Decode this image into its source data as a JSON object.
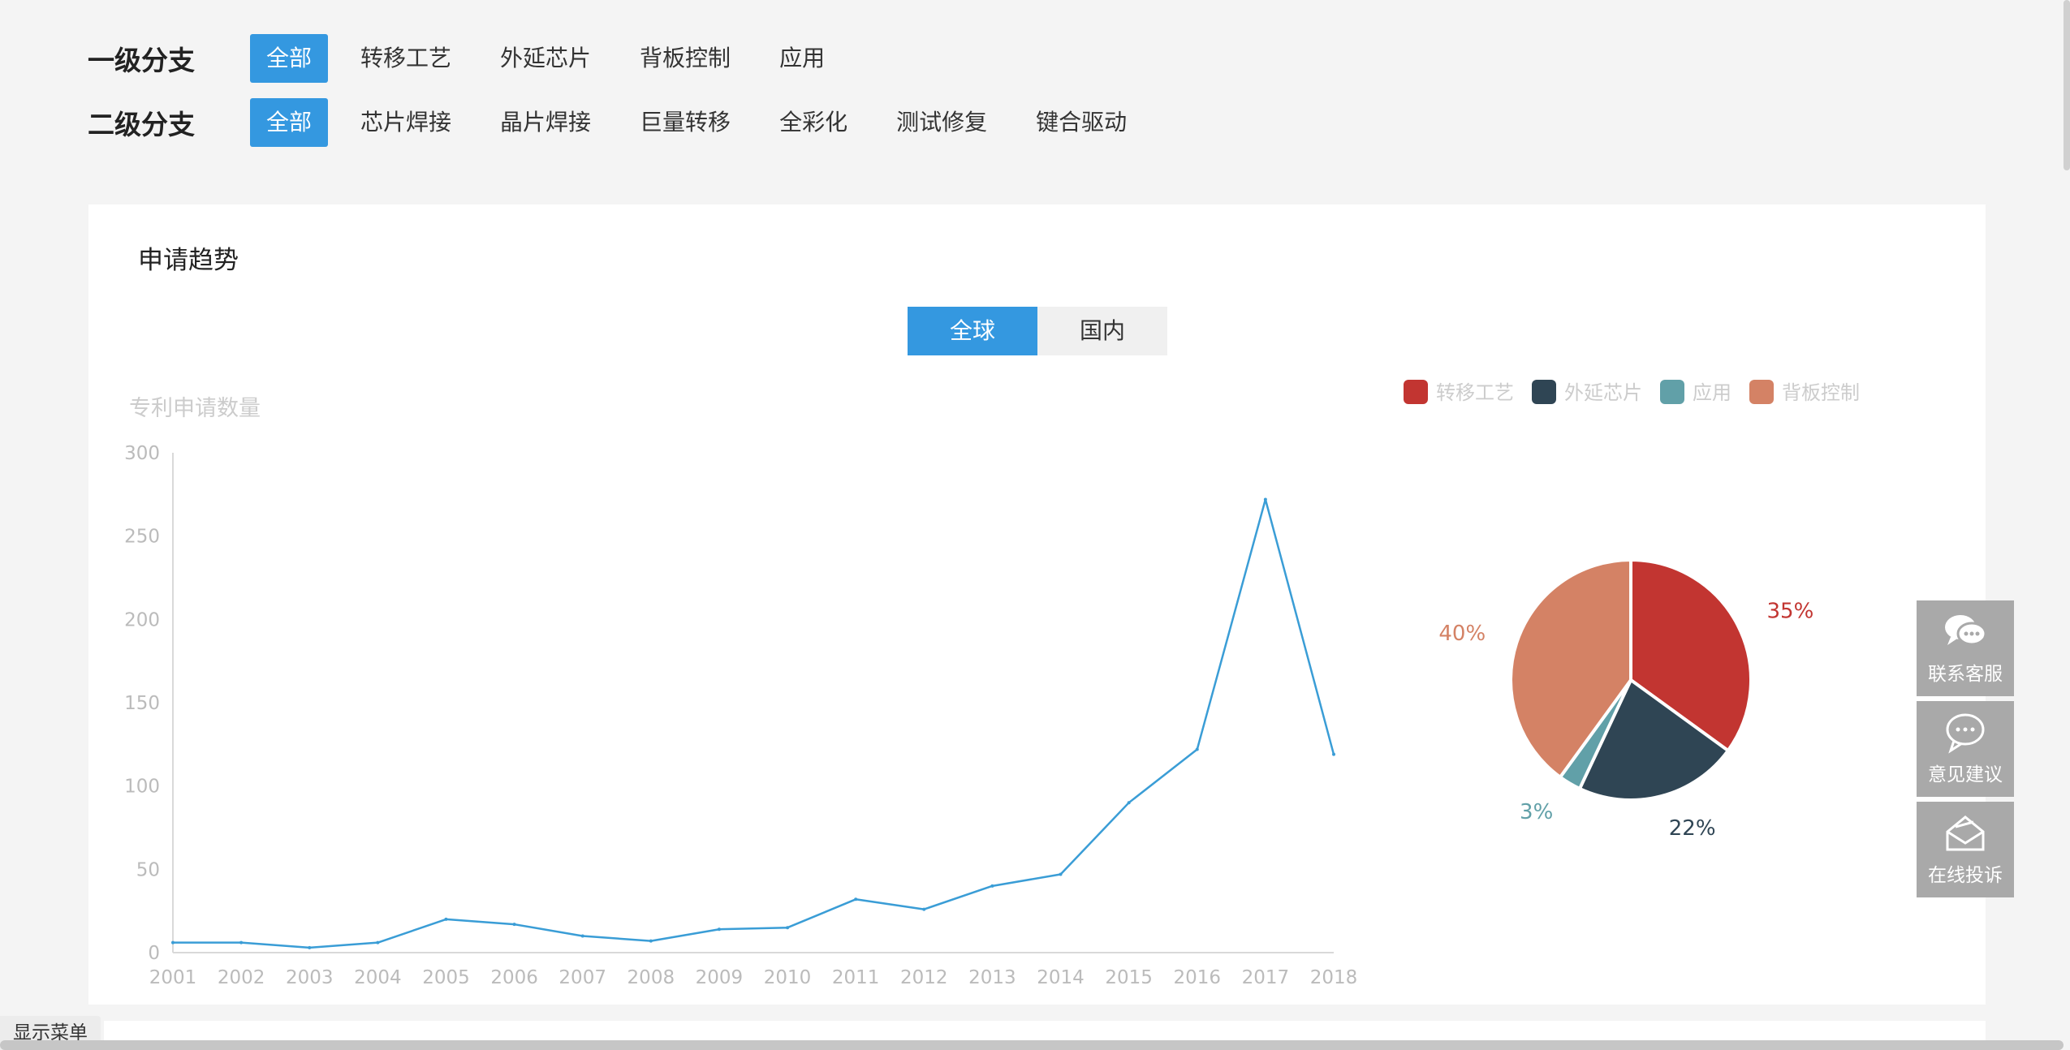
{
  "filters": {
    "level1": {
      "label": "一级分支",
      "options": [
        "全部",
        "转移工艺",
        "外延芯片",
        "背板控制",
        "应用"
      ],
      "active": 0
    },
    "level2": {
      "label": "二级分支",
      "options": [
        "全部",
        "芯片焊接",
        "晶片焊接",
        "巨量转移",
        "全彩化",
        "测试修复",
        "键合驱动"
      ],
      "active": 0
    }
  },
  "card": {
    "title": "申请趋势"
  },
  "scope_toggle": {
    "options": [
      "全球",
      "国内"
    ],
    "active": 0
  },
  "colors": {
    "accent": "#3498e0",
    "line": "#3a9dd6",
    "axis": "#d9d9d9",
    "axis_text": "#bbbbbb"
  },
  "chart_data": [
    {
      "type": "line",
      "ylabel": "专利申请数量",
      "ylim": [
        0,
        300
      ],
      "yticks": [
        0,
        50,
        100,
        150,
        200,
        250,
        300
      ],
      "x": [
        "2001",
        "2002",
        "2003",
        "2004",
        "2005",
        "2006",
        "2007",
        "2008",
        "2009",
        "2010",
        "2011",
        "2012",
        "2013",
        "2014",
        "2015",
        "2016",
        "2017",
        "2018"
      ],
      "series": [
        {
          "values": [
            6,
            6,
            3,
            6,
            20,
            17,
            10,
            7,
            14,
            15,
            32,
            26,
            40,
            47,
            90,
            122,
            272,
            119
          ]
        }
      ]
    },
    {
      "type": "pie",
      "legend_position": "top",
      "slices": [
        {
          "name": "转移工艺",
          "value": 35,
          "label": "35%",
          "color": "#c23531"
        },
        {
          "name": "外延芯片",
          "value": 22,
          "label": "22%",
          "color": "#2f4554"
        },
        {
          "name": "应用",
          "value": 3,
          "label": "3%",
          "color": "#61a0a8"
        },
        {
          "name": "背板控制",
          "value": 40,
          "label": "40%",
          "color": "#d48265"
        }
      ]
    }
  ],
  "side_tools": [
    {
      "label": "联系客服",
      "icon": "chat-bubbles-icon"
    },
    {
      "label": "意见建议",
      "icon": "comment-icon"
    },
    {
      "label": "在线投诉",
      "icon": "envelope-icon"
    }
  ],
  "menu_button": "显示菜单"
}
